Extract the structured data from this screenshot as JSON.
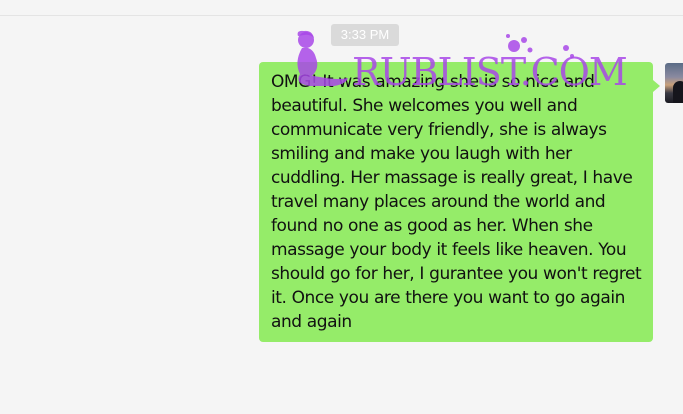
{
  "chat": {
    "timestamp": "3:33 PM",
    "message": "OMG! It was amazing she is so nice and beautiful. She welcomes you well and communicate very friendly, she is always smiling and make you laugh with her cuddling. Her massage is really great, I have travel many places around the world and found no one as good as her. When she massage your body it feels like heaven. You should go for her, I gurantee you won't regret it. Once you are there you want to go again and again"
  },
  "watermark": {
    "text": "RUBLIST.COM"
  },
  "colors": {
    "background": "#f5f5f5",
    "bubble": "#95ec69",
    "timestamp_bg": "#dadada",
    "watermark": "#a848e8"
  },
  "icons": {
    "avatar": "user-avatar-photo",
    "watermark_logo": "woman-silhouette-logo"
  }
}
